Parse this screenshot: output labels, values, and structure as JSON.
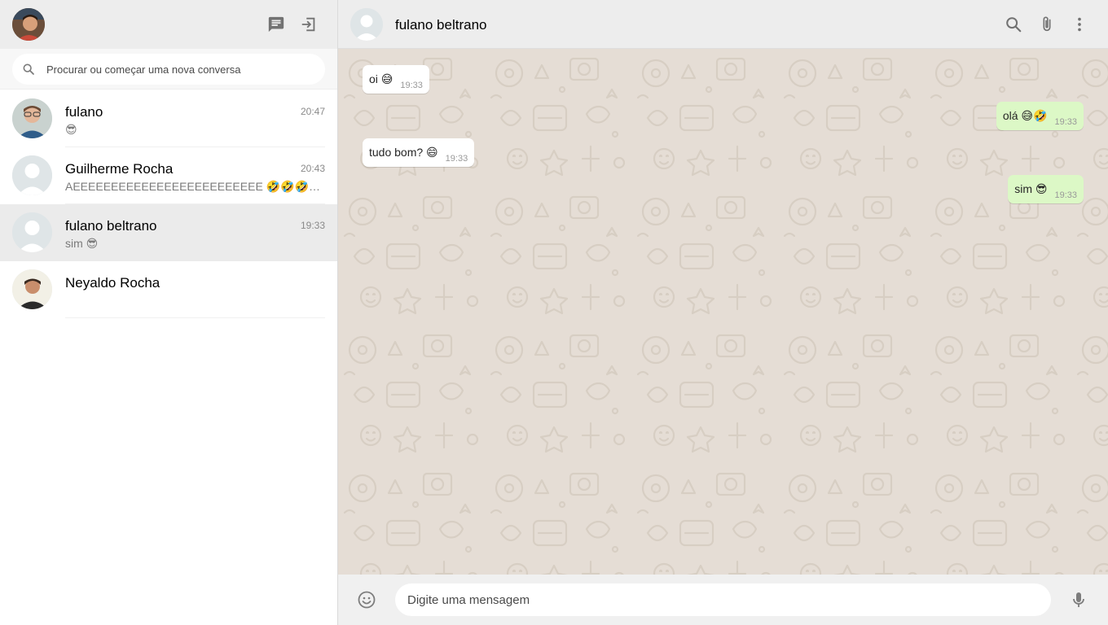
{
  "sidebar": {
    "search_placeholder": "Procurar ou começar uma nova conversa",
    "chats": [
      {
        "name": "fulano",
        "time": "20:47",
        "last": "😎",
        "avatar": "photo"
      },
      {
        "name": "Guilherme Rocha",
        "time": "20:43",
        "last": "AEEEEEEEEEEEEEEEEEEEEEEEEE 🤣🤣🤣🤣🤣🤣🤣🤣",
        "avatar": "default"
      },
      {
        "name": "fulano beltrano",
        "time": "19:33",
        "last": "sim 😎",
        "avatar": "default",
        "active": true
      },
      {
        "name": "Neyaldo Rocha",
        "time": "",
        "last": "",
        "avatar": "photo"
      }
    ]
  },
  "chat": {
    "contact_name": "fulano beltrano",
    "messages": [
      {
        "text": "oi 😅",
        "time": "19:33",
        "direction": "in"
      },
      {
        "text": "olá 😅🤣",
        "time": "19:33",
        "direction": "out"
      },
      {
        "text": "tudo bom? 😄",
        "time": "19:33",
        "direction": "in"
      },
      {
        "text": "sim 😎",
        "time": "19:33",
        "direction": "out"
      }
    ],
    "input_placeholder": "Digite uma mensagem"
  },
  "icons": {
    "new_chat": "chat-icon",
    "logout": "exit-icon",
    "search": "search-icon",
    "attach": "paperclip-icon",
    "menu": "more-vertical-icon",
    "emoji": "smiley-icon",
    "mic": "microphone-icon"
  },
  "colors": {
    "header_bg": "#ededed",
    "chat_bg": "#e5ddd5",
    "outgoing_bubble": "#dcf8c6",
    "incoming_bubble": "#ffffff",
    "active_chat": "#ebebeb"
  }
}
